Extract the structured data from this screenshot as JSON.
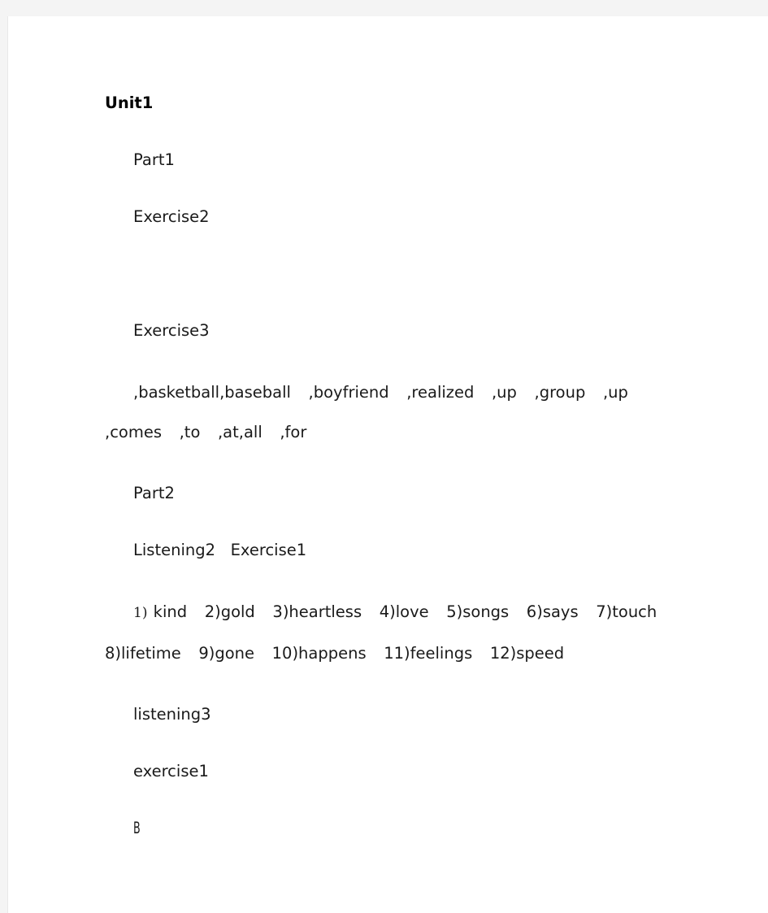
{
  "document": {
    "background_color": "#f4f4f4",
    "page_color": "#ffffff",
    "text_color": "#1a1a1a",
    "title": "Unit1",
    "blocks": [
      {
        "id": "unit-heading",
        "text": "Unit1"
      },
      {
        "id": "part1",
        "text": "Part1"
      },
      {
        "id": "exercise2",
        "text": "Exercise2"
      },
      {
        "id": "exercise3",
        "text": "Exercise3"
      },
      {
        "id": "exercise3-answers",
        "text": ",basketball,baseball   ,boyfriend   ,realized   ,up   ,group   ,up   ,comes   ,to   ,at,all   ,for"
      },
      {
        "id": "part2",
        "text": "Part2"
      },
      {
        "id": "listening2",
        "text": "Listening2   Exercise1"
      },
      {
        "id": "listening2-answers-marker",
        "text": "1)"
      },
      {
        "id": "listening2-answers",
        "text": " kind   2)gold   3)heartless   4)love   5)songs   6)says   7)touch   8)lifetime   9)gone   10)happens   11)feelings   12)speed"
      },
      {
        "id": "listening3",
        "text": "listening3"
      },
      {
        "id": "exercise1",
        "text": "exercise1"
      },
      {
        "id": "answer-b",
        "text": "B"
      }
    ]
  }
}
